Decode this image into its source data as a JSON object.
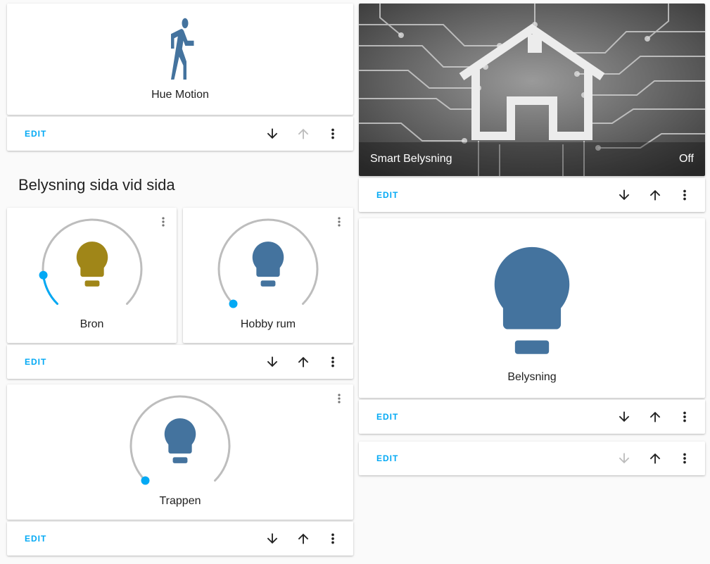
{
  "colors": {
    "accent": "#03a9f4",
    "icon_off": "#44739e",
    "icon_on": "#a08618",
    "slider_track": "#bdbdbd",
    "disabled": "#bdbdbd"
  },
  "icons": {
    "move_down": "arrow-down-icon",
    "move_up": "arrow-up-icon",
    "menu": "dots-vertical-icon",
    "motion": "walk-icon",
    "light": "lightbulb-icon"
  },
  "labels": {
    "edit": "EDIT"
  },
  "motion_card": {
    "name": "Hue Motion"
  },
  "section": {
    "title": "Belysning sida vid sida"
  },
  "lights": [
    {
      "name": "Bron",
      "brightness": 0.14,
      "state": "on"
    },
    {
      "name": "Hobby rum",
      "brightness": 0.0,
      "state": "off"
    },
    {
      "name": "Trappen",
      "brightness": 0.0,
      "state": "off"
    }
  ],
  "picture_card": {
    "name": "Smart Belysning",
    "state": "Off"
  },
  "big_light": {
    "name": "Belysning"
  }
}
